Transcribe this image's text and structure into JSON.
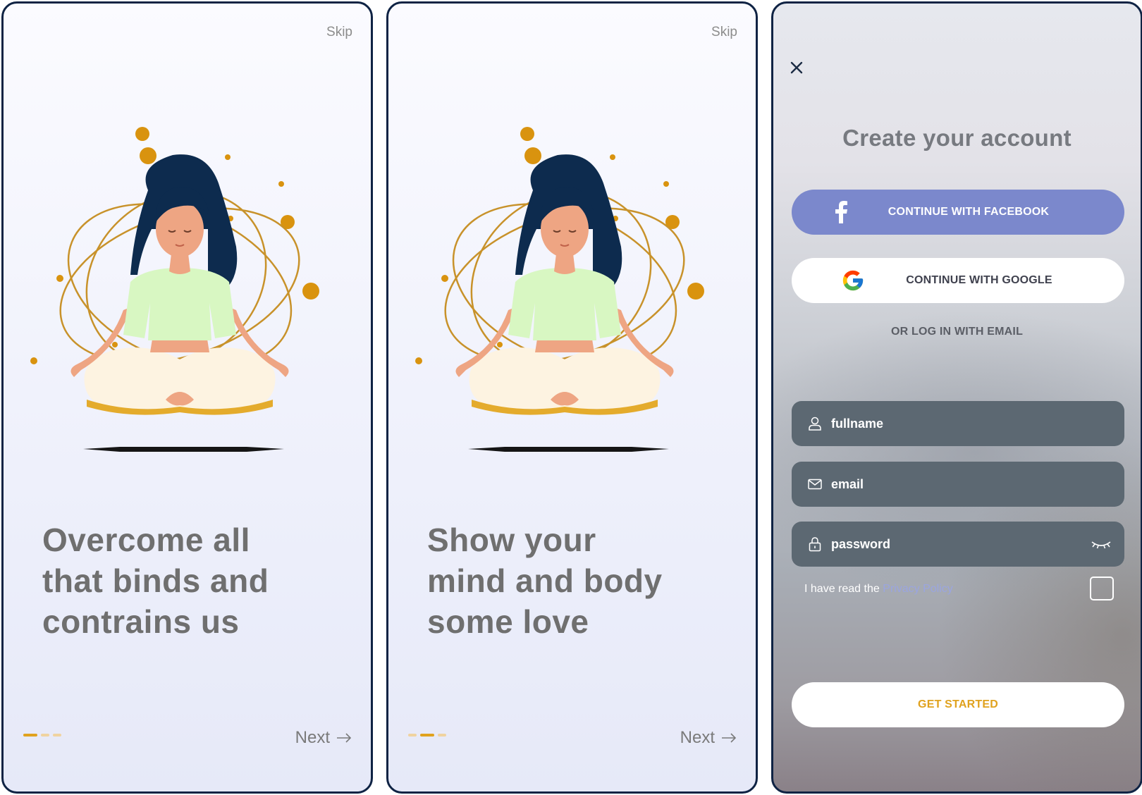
{
  "screens": [
    {
      "skip_label": "Skip",
      "headline": "Overcome all\nthat binds and\ncontrains us",
      "next_label": "Next",
      "page_indicator": {
        "total": 3,
        "active": 1
      }
    },
    {
      "skip_label": "Skip",
      "headline": "Show your\nmind and body\nsome love",
      "next_label": "Next",
      "page_indicator": {
        "total": 3,
        "active": 2
      }
    }
  ],
  "signup": {
    "title": "Create your account",
    "facebook_label": "CONTINUE WITH FACEBOOK",
    "google_label": "CONTINUE WITH GOOGLE",
    "or_email_label": "OR LOG IN WITH EMAIL",
    "fullname_placeholder": "fullname",
    "email_placeholder": "email",
    "password_placeholder": "password",
    "policy_prefix": "I have read the ",
    "policy_link": "Privacy Policy",
    "policy_checked": false,
    "get_started_label": "GET STARTED"
  },
  "colors": {
    "accent": "#e0a21e",
    "facebook": "#7b88cc",
    "field_bg": "#5c6872",
    "headline": "#6f6f6f",
    "frame_border": "#0f2344",
    "policy_link": "#9aa5e0"
  },
  "icons": {
    "close": "close-icon",
    "facebook": "facebook-icon",
    "google": "google-icon",
    "user": "user-icon",
    "mail": "mail-icon",
    "lock": "lock-icon",
    "eye": "eye-closed-icon",
    "arrow": "arrow-right-icon"
  }
}
